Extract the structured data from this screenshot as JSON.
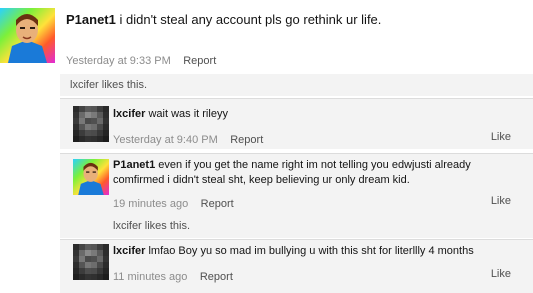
{
  "post": {
    "username": "P1anet1",
    "message": " i didn't steal any account pls go rethink ur life.",
    "time": "Yesterday at 9:33 PM",
    "report": "Report"
  },
  "post_likes": "lxcifer likes this.",
  "replies": [
    {
      "username": "lxcifer",
      "message": " wait was it rileyy",
      "time": "Yesterday at 9:40 PM",
      "report": "Report",
      "like": "Like"
    },
    {
      "username": "P1anet1",
      "message": " even if you get the name right im not telling you edwjusti already comfirmed i didn't steal sht, keep believing ur only dream kid.",
      "time": "19 minutes ago",
      "report": "Report",
      "like": "Like",
      "likes": "lxcifer likes this."
    },
    {
      "username": "lxcifer",
      "message": " lmfao Boy yu so mad im bullying u with this sht for literllly 4 months",
      "time": "11 minutes ago",
      "report": "Report",
      "like": "Like"
    }
  ]
}
